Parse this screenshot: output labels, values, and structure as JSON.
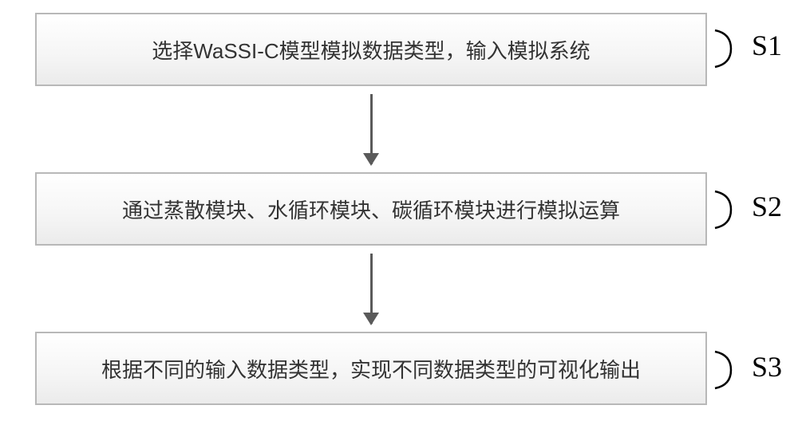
{
  "steps": {
    "s1": {
      "text": "选择WaSSI-C模型模拟数据类型，输入模拟系统",
      "label": "S1"
    },
    "s2": {
      "text": "通过蒸散模块、水循环模块、碳循环模块进行模拟运算",
      "label": "S2"
    },
    "s3": {
      "text": "根据不同的输入数据类型，实现不同数据类型的可视化输出",
      "label": "S3"
    }
  },
  "chart_data": {
    "type": "flowchart",
    "direction": "top-to-bottom",
    "nodes": [
      {
        "id": "S1",
        "text": "选择WaSSI-C模型模拟数据类型，输入模拟系统"
      },
      {
        "id": "S2",
        "text": "通过蒸散模块、水循环模块、碳循环模块进行模拟运算"
      },
      {
        "id": "S3",
        "text": "根据不同的输入数据类型，实现不同数据类型的可视化输出"
      }
    ],
    "edges": [
      {
        "from": "S1",
        "to": "S2"
      },
      {
        "from": "S2",
        "to": "S3"
      }
    ]
  }
}
